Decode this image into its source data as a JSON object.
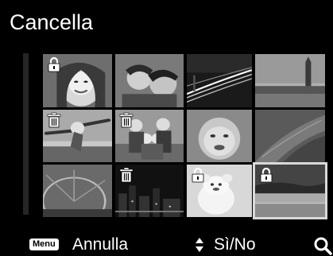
{
  "header": {
    "title": "Cancella"
  },
  "footer": {
    "menu_key": "Menu",
    "cancel_label": "Annulla",
    "toggle_label": "Sì/No"
  },
  "icons": {
    "lock": "lock-icon",
    "trash": "trash-icon",
    "updown": "up-down-arrows-icon",
    "zoom": "magnifier-icon"
  },
  "grid": {
    "columns": 4,
    "rows": 3,
    "selected_index": 11,
    "items": [
      {
        "scene": "girl-portrait",
        "badge": "lock"
      },
      {
        "scene": "couple-portrait",
        "badge": ""
      },
      {
        "scene": "night-highway",
        "badge": ""
      },
      {
        "scene": "big-ben-skyline",
        "badge": ""
      },
      {
        "scene": "girl-jumping",
        "badge": "trash"
      },
      {
        "scene": "family-group",
        "badge": "trash"
      },
      {
        "scene": "baby-face",
        "badge": ""
      },
      {
        "scene": "leaf-closeup",
        "badge": ""
      },
      {
        "scene": "ferris-wheel",
        "badge": ""
      },
      {
        "scene": "night-city",
        "badge": "trash"
      },
      {
        "scene": "teddy-bear",
        "badge": "lock"
      },
      {
        "scene": "beach-horizon",
        "badge": "lock"
      }
    ]
  }
}
